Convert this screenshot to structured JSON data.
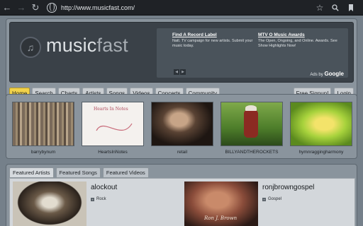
{
  "browser": {
    "back_icon": "back-arrow-icon",
    "forward_icon": "forward-arrow-icon",
    "reload_icon": "reload-icon",
    "url": "http://www.musicfast.com/",
    "icons": [
      "globe-icon",
      "star-icon",
      "search-icon",
      "bookmarks-icon"
    ]
  },
  "header": {
    "logo_main": "music",
    "logo_accent": "fast",
    "ads": [
      {
        "title": "Find A Record Label",
        "text": "Natl. TV campaign for new artists. Submit your music today."
      },
      {
        "title": "MTV O Music Awards",
        "text": "The Open, Ongoing, and Online. Awards. See Show Highlights Now!"
      }
    ],
    "ads_by_prefix": "Ads by",
    "ads_by_brand": "Google"
  },
  "nav": {
    "items": [
      "Home",
      "Search",
      "Charts",
      "Artists",
      "Songs",
      "Videos",
      "Concerts",
      "Community"
    ],
    "active": "Home",
    "right": [
      "Free Signup!",
      "Login"
    ]
  },
  "artists": [
    {
      "name": "barrybynum"
    },
    {
      "name": "HeartsInNotes",
      "art_caption": "Hearts In Notes"
    },
    {
      "name": "retail"
    },
    {
      "name": "BILLYANDTHEROCKETS"
    },
    {
      "name": "hymnraggingharmony"
    }
  ],
  "featured": {
    "tabs": [
      "Featured Artists",
      "Featured Songs",
      "Featured Videos"
    ],
    "active": "Featured Artists",
    "items": [
      {
        "name": "alockout",
        "genre": "Rock"
      },
      {
        "name": "ronjbrowngospel",
        "genre": "Gospel",
        "art_caption": "Ron J. Brown"
      }
    ]
  },
  "colors": {
    "active_tab": "#f2d24a",
    "banner": "#3a4148",
    "panel": "#8a949d"
  }
}
